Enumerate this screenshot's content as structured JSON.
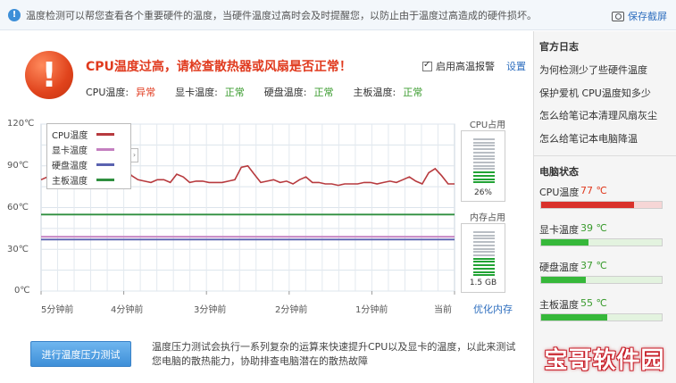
{
  "topbar": {
    "info_icon": "info-icon",
    "text": "温度检测可以帮您查看各个重要硬件的温度，当硬件温度过高时会及时提醒您，以防止由于温度过高造成的硬件损坏。",
    "save_label": "保存截屏",
    "save_icon": "camera-icon"
  },
  "alert": {
    "icon": "exclamation-icon",
    "glyph": "!",
    "title": "CPU温度过高，请检查散热器或风扇是否正常！",
    "alarm_label": "启用高温报警",
    "alarm_checked": true,
    "settings_label": "设置"
  },
  "status": [
    {
      "label": "CPU温度:",
      "value": "异常",
      "state": "bad"
    },
    {
      "label": "显卡温度:",
      "value": "正常",
      "state": "ok"
    },
    {
      "label": "硬盘温度:",
      "value": "正常",
      "state": "ok"
    },
    {
      "label": "主板温度:",
      "value": "正常",
      "state": "ok"
    }
  ],
  "chart_data": {
    "type": "line",
    "y_ticks": [
      "120℃",
      "90℃",
      "60℃",
      "30℃",
      "0℃"
    ],
    "ylim": [
      0,
      120
    ],
    "x_ticks": [
      "5分钟前",
      "4分钟前",
      "3分钟前",
      "2分钟前",
      "1分钟前",
      "当前"
    ],
    "grid": true,
    "legend_position": "top-left",
    "series": [
      {
        "name": "CPU温度",
        "color": "#b73a3e",
        "values": [
          80,
          82,
          79,
          88,
          77,
          85,
          80,
          78,
          84,
          80,
          86,
          81,
          77,
          90,
          83,
          80,
          79,
          78,
          80,
          80,
          78,
          84,
          82,
          78,
          79,
          79,
          78,
          78,
          78,
          79,
          80,
          89,
          90,
          84,
          78,
          79,
          80,
          78,
          79,
          77,
          80,
          82,
          78,
          78,
          77,
          77,
          76,
          77,
          77,
          77,
          78,
          78,
          77,
          78,
          79,
          78,
          80,
          82,
          79,
          77,
          85,
          88,
          83,
          77,
          77
        ]
      },
      {
        "name": "显卡温度",
        "color": "#c47fc0",
        "values": [
          39,
          39
        ]
      },
      {
        "name": "硬盘温度",
        "color": "#5a62b0",
        "values": [
          37,
          37
        ]
      },
      {
        "name": "主板温度",
        "color": "#2f8f3f",
        "values": [
          55,
          55
        ]
      }
    ]
  },
  "legend_toggle": "›",
  "cpu_meter": {
    "title": "CPU占用",
    "value": "26%",
    "level": 0.26
  },
  "mem_meter": {
    "title": "内存占用",
    "value": "1.5 GB",
    "level": 0.4
  },
  "optimize_label": "优化内存",
  "test_button": "进行温度压力测试",
  "test_desc": "温度压力测试会执行一系列复杂的运算来快速提升CPU以及显卡的温度，以此来测试您电脑的散热能力，协助排查电脑潜在的散热故障",
  "side": {
    "blog_title": "官方日志",
    "blog_items": [
      "为何检测少了些硬件温度",
      "保护爱机 CPU温度知多少",
      "怎么给笔记本清理风扇灰尘",
      "怎么给笔记本电脑降温"
    ],
    "pc_title": "电脑状态",
    "pc_items": [
      {
        "name": "CPU温度",
        "temp": "77 ℃",
        "level": 0.77,
        "color": "#e03a1e",
        "fill": "#d9312b",
        "track": "#f6d6d6"
      },
      {
        "name": "显卡温度",
        "temp": "39 ℃",
        "level": 0.39,
        "color": "#3a9b2e",
        "fill": "#36b83a",
        "track": "#e3f3df"
      },
      {
        "name": "硬盘温度",
        "temp": "37 ℃",
        "level": 0.37,
        "color": "#3a9b2e",
        "fill": "#36b83a",
        "track": "#e3f3df"
      },
      {
        "name": "主板温度",
        "temp": "55 ℃",
        "level": 0.55,
        "color": "#3a9b2e",
        "fill": "#36b83a",
        "track": "#e3f3df"
      }
    ]
  },
  "watermark": "宝哥软件园"
}
